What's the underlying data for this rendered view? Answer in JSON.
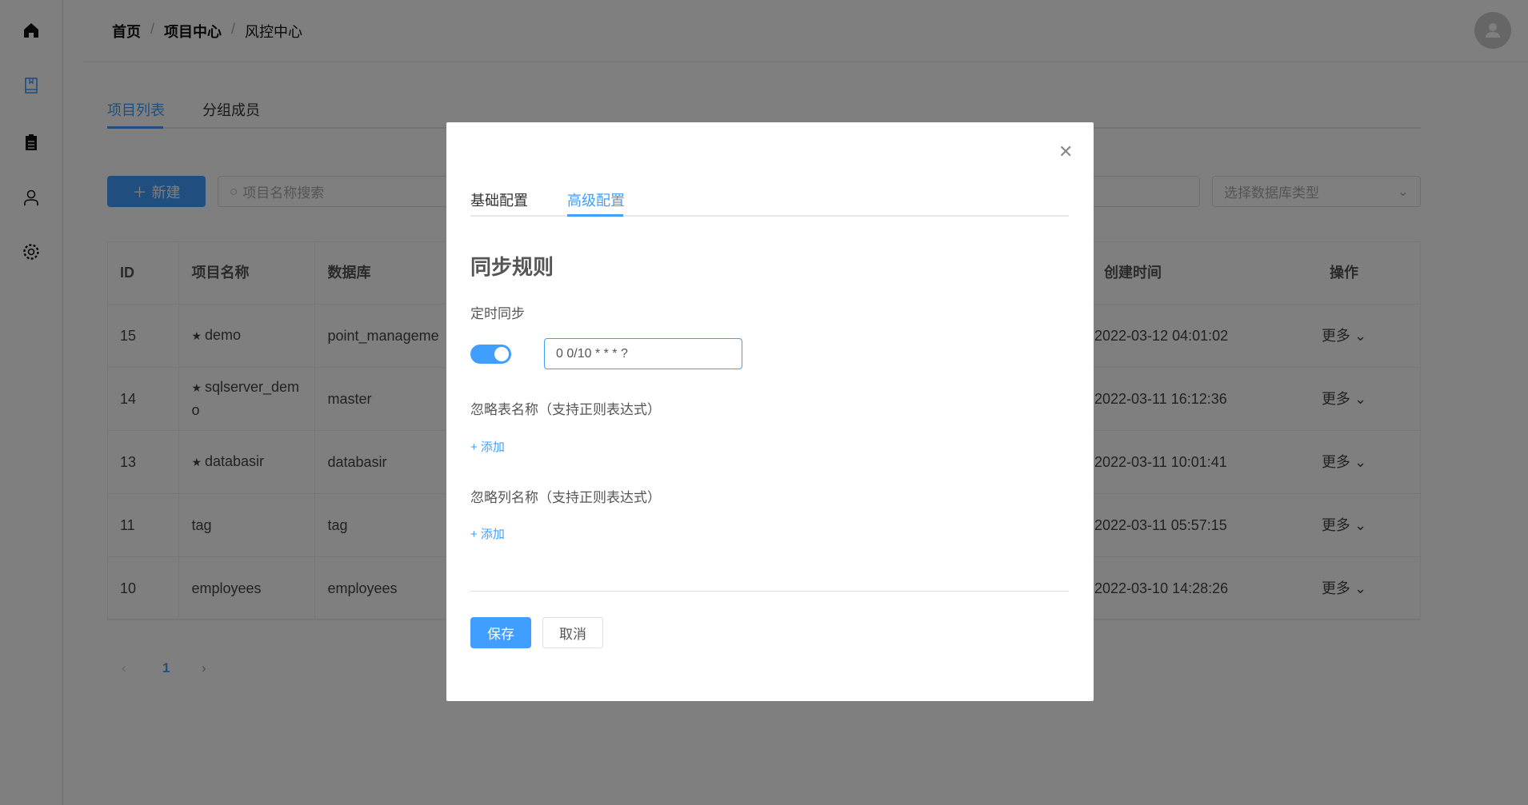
{
  "breadcrumb": [
    "首页",
    "项目中心",
    "风控中心"
  ],
  "tabs": [
    "项目列表",
    "分组成员"
  ],
  "toolbar": {
    "new_label": "新建",
    "search_placeholder": "项目名称搜索",
    "db_type_placeholder": "选择数据库类型"
  },
  "table": {
    "headers": [
      "ID",
      "项目名称",
      "数据库",
      "创建时间",
      "操作"
    ],
    "rows": [
      {
        "id": "15",
        "name": "demo",
        "starred": true,
        "db": "point_manageme",
        "created": "2022-03-12 04:01:02",
        "action": "更多"
      },
      {
        "id": "14",
        "name": "sqlserver_demo",
        "starred": true,
        "db": "master",
        "created": "2022-03-11 16:12:36",
        "action": "更多"
      },
      {
        "id": "13",
        "name": "databasir",
        "starred": true,
        "db": "databasir",
        "created": "2022-03-11 10:01:41",
        "action": "更多"
      },
      {
        "id": "11",
        "name": "tag",
        "starred": false,
        "db": "tag",
        "created": "2022-03-11 05:57:15",
        "action": "更多"
      },
      {
        "id": "10",
        "name": "employees",
        "starred": false,
        "db": "employees",
        "created": "2022-03-10 14:28:26",
        "action": "更多"
      }
    ]
  },
  "pagination": {
    "current": "1"
  },
  "modal": {
    "tabs": [
      "基础配置",
      "高级配置"
    ],
    "active_tab": "高级配置",
    "section_title": "同步规则",
    "schedule_label": "定时同步",
    "schedule_enabled": true,
    "cron_value": "0 0/10 * * * ?",
    "ignore_table_label": "忽略表名称（支持正则表达式）",
    "ignore_column_label": "忽略列名称（支持正则表达式）",
    "add_label": "+ 添加",
    "save_label": "保存",
    "cancel_label": "取消"
  },
  "colors": {
    "accent": "#409eff"
  }
}
